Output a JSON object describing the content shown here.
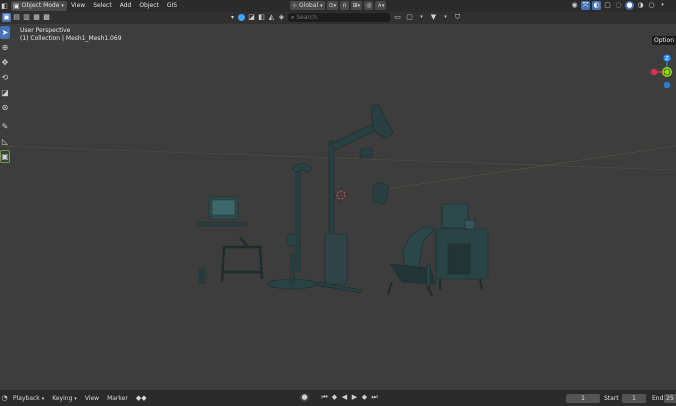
{
  "header": {
    "mode_label": "Object Mode",
    "menu": [
      "View",
      "Select",
      "Add",
      "Object",
      "GIS"
    ],
    "transform_orientation": "Global"
  },
  "secondbar": {
    "search_placeholder": "Search"
  },
  "viewport": {
    "perspective_label": "User Perspective",
    "collection_label": "(1) Collection | Mesh1_Mesh1.069",
    "options_label": "Option"
  },
  "gizmo": {
    "x_label": "X",
    "y_label": "Y",
    "z_label": "Z"
  },
  "timeline": {
    "playback_label": "Playback",
    "keying_label": "Keying",
    "view_label": "View",
    "marker_label": "Marker",
    "current_frame": "1",
    "start_label": "Start",
    "start_value": "1",
    "end_label": "End",
    "end_value": "25"
  },
  "colors": {
    "accent": "#4772b3",
    "axis_x": "#ff3352",
    "axis_y": "#8bdc00",
    "axis_z": "#2890ff",
    "model": "#2a4a4c"
  }
}
